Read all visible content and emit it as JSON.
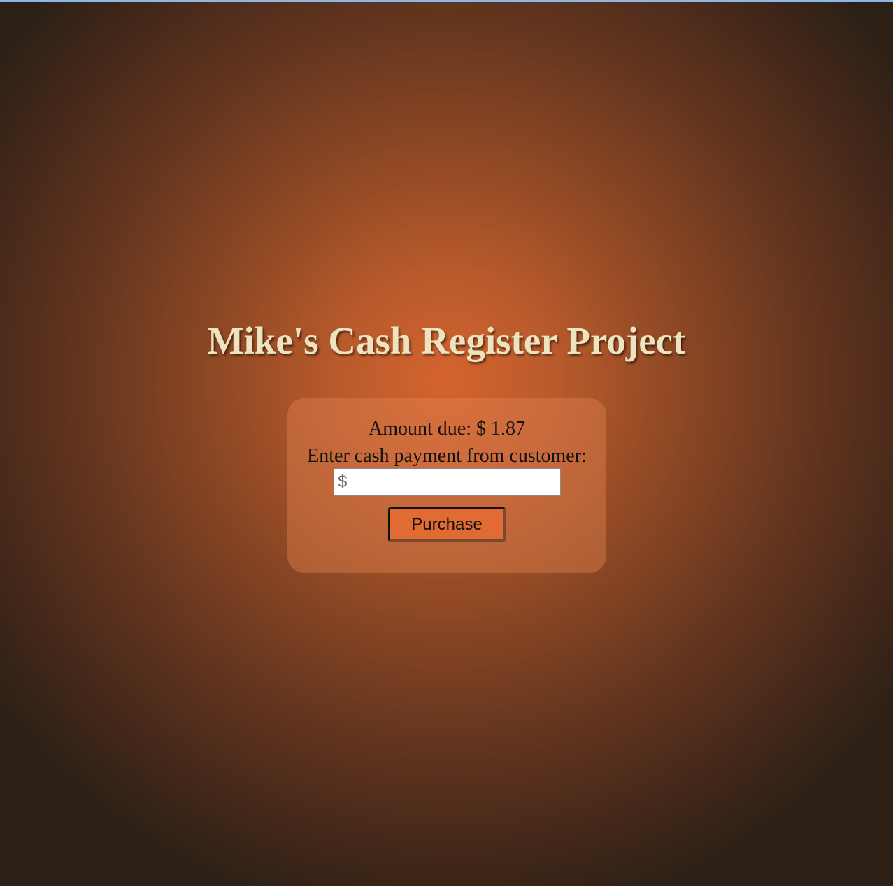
{
  "page": {
    "title": "Mike's Cash Register Project"
  },
  "register": {
    "amount_due_text": "Amount due: $ 1.87",
    "amount_due_value": 1.87,
    "prompt": "Enter cash payment from customer:",
    "cash_input": {
      "placeholder": "$",
      "value": ""
    },
    "purchase_label": "Purchase"
  },
  "colors": {
    "title": "#ede3bf",
    "accent": "#e06c34",
    "top_strip": "#8fb7e6"
  }
}
